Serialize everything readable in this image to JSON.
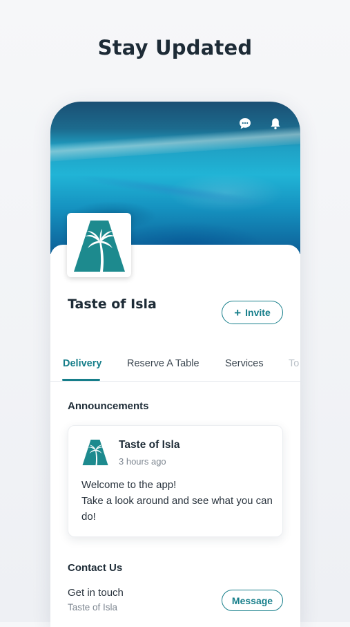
{
  "headline": "Stay Updated",
  "header": {
    "icons": [
      "chat-icon",
      "bell-icon"
    ]
  },
  "business": {
    "name": "Taste of Isla",
    "logo_icon": "palm-tree-logo-icon",
    "invite_label": "Invite"
  },
  "tabs": [
    {
      "label": "Delivery",
      "active": true
    },
    {
      "label": "Reserve A Table",
      "active": false
    },
    {
      "label": "Services",
      "active": false
    },
    {
      "label": "To",
      "active": false
    }
  ],
  "announcements": {
    "title": "Announcements",
    "post": {
      "author": "Taste of Isla",
      "time": "3 hours ago",
      "body_line1": "Welcome to the app!",
      "body_line2": "Take a look around and see what you can do!"
    }
  },
  "contact": {
    "title": "Contact Us",
    "label": "Get in touch",
    "sub": "Taste of Isla",
    "button_label": "Message"
  },
  "colors": {
    "accent": "#167e8a",
    "logo_teal": "#1d8a8e",
    "text_dark": "#1d2b36"
  }
}
